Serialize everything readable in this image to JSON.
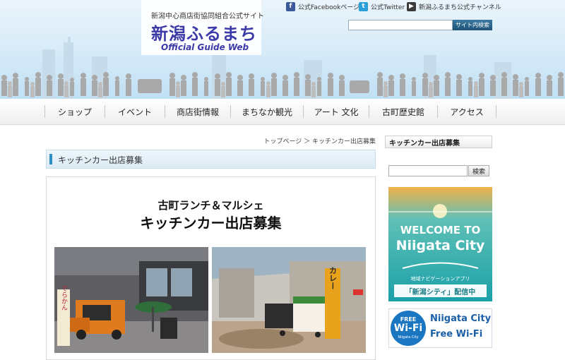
{
  "header": {
    "site_tagline": "新潟中心商店街協同組合公式サイト",
    "site_name": "新潟ふるまち",
    "site_name_en": "Official Guide Web",
    "social_links": [
      {
        "label": "公式Facebookページ",
        "icon": "facebook-icon",
        "color": "#3b5998"
      },
      {
        "label": "公式Twitter",
        "icon": "twitter-icon",
        "color": "#2a9fd8"
      },
      {
        "label": "新潟ふるまち公式チャンネル",
        "icon": "youtube-icon",
        "color": "#3a3a3a"
      }
    ],
    "search": {
      "value": "",
      "button_label": "サイト内検索"
    }
  },
  "nav": {
    "items": [
      "ショップ",
      "イベント",
      "商店街情報",
      "まちなか観光",
      "アート 文化",
      "古町歴史館",
      "アクセス"
    ]
  },
  "main": {
    "breadcrumb": "トップページ ＞ キッチンカー出店募集",
    "page_title": "キッチンカー出店募集",
    "event_subtitle": "古町ランチ＆マルシェ",
    "event_title": "キッチンカー出店募集",
    "photos": [
      {
        "icon": "kitchen-car-photo-icon",
        "sign_text": "でらかん"
      },
      {
        "icon": "arcade-market-photo-icon",
        "sign_text": "カレー"
      }
    ]
  },
  "sidebar": {
    "heading": "キッチンカー出店募集",
    "search": {
      "value": "",
      "button_label": "検索"
    },
    "banner_welcome": {
      "line1": "WELCOME TO",
      "line2": "Niigata City",
      "caption": "地域ナビゲーションアプリ",
      "app_name": "「新潟シティ」配信中"
    },
    "banner_wifi": {
      "badge_top": "FREE",
      "badge_main": "Wi-Fi",
      "badge_small": "Niigata City",
      "line1": "Niigata City",
      "line2": "Free Wi-Fi"
    }
  },
  "colors": {
    "accent": "#2f8fc2",
    "logo": "#3b3aa8",
    "banner_teal": "#1aa0a8",
    "wifi_blue": "#1b76c2"
  }
}
